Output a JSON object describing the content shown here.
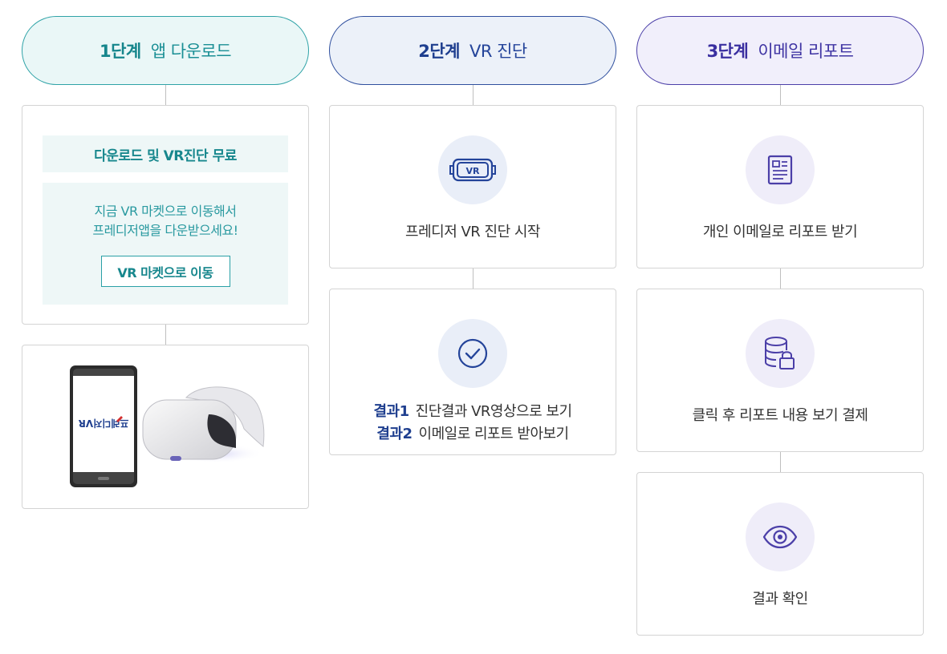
{
  "steps": [
    {
      "num": "1단계",
      "title": "앱 다운로드"
    },
    {
      "num": "2단계",
      "title": "VR 진단"
    },
    {
      "num": "3단계",
      "title": "이메일 리포트"
    }
  ],
  "download": {
    "heading": "다운로드 및 VR진단 무료",
    "line1": "지금 VR 마켓으로 이동해서",
    "line2": "프레디저앱을 다운받으세요!",
    "button": "VR 마켓으로 이동",
    "phone_logo": "프레디저VR"
  },
  "vr": {
    "start_label": "프레디저 VR 진단 시작",
    "icon_text": "VR",
    "results": [
      {
        "key": "결과1",
        "text": "진단결과 VR영상으로 보기"
      },
      {
        "key": "결과2",
        "text": "이메일로 리포트 받아보기"
      }
    ]
  },
  "email": {
    "receive_label": "개인 이메일로 리포트 받기",
    "pay_label": "클릭 후 리포트 내용 보기 결제",
    "confirm_label": "결과 확인"
  },
  "colors": {
    "step1": "#1a8f95",
    "step2": "#24449a",
    "step3": "#3f34a3"
  }
}
